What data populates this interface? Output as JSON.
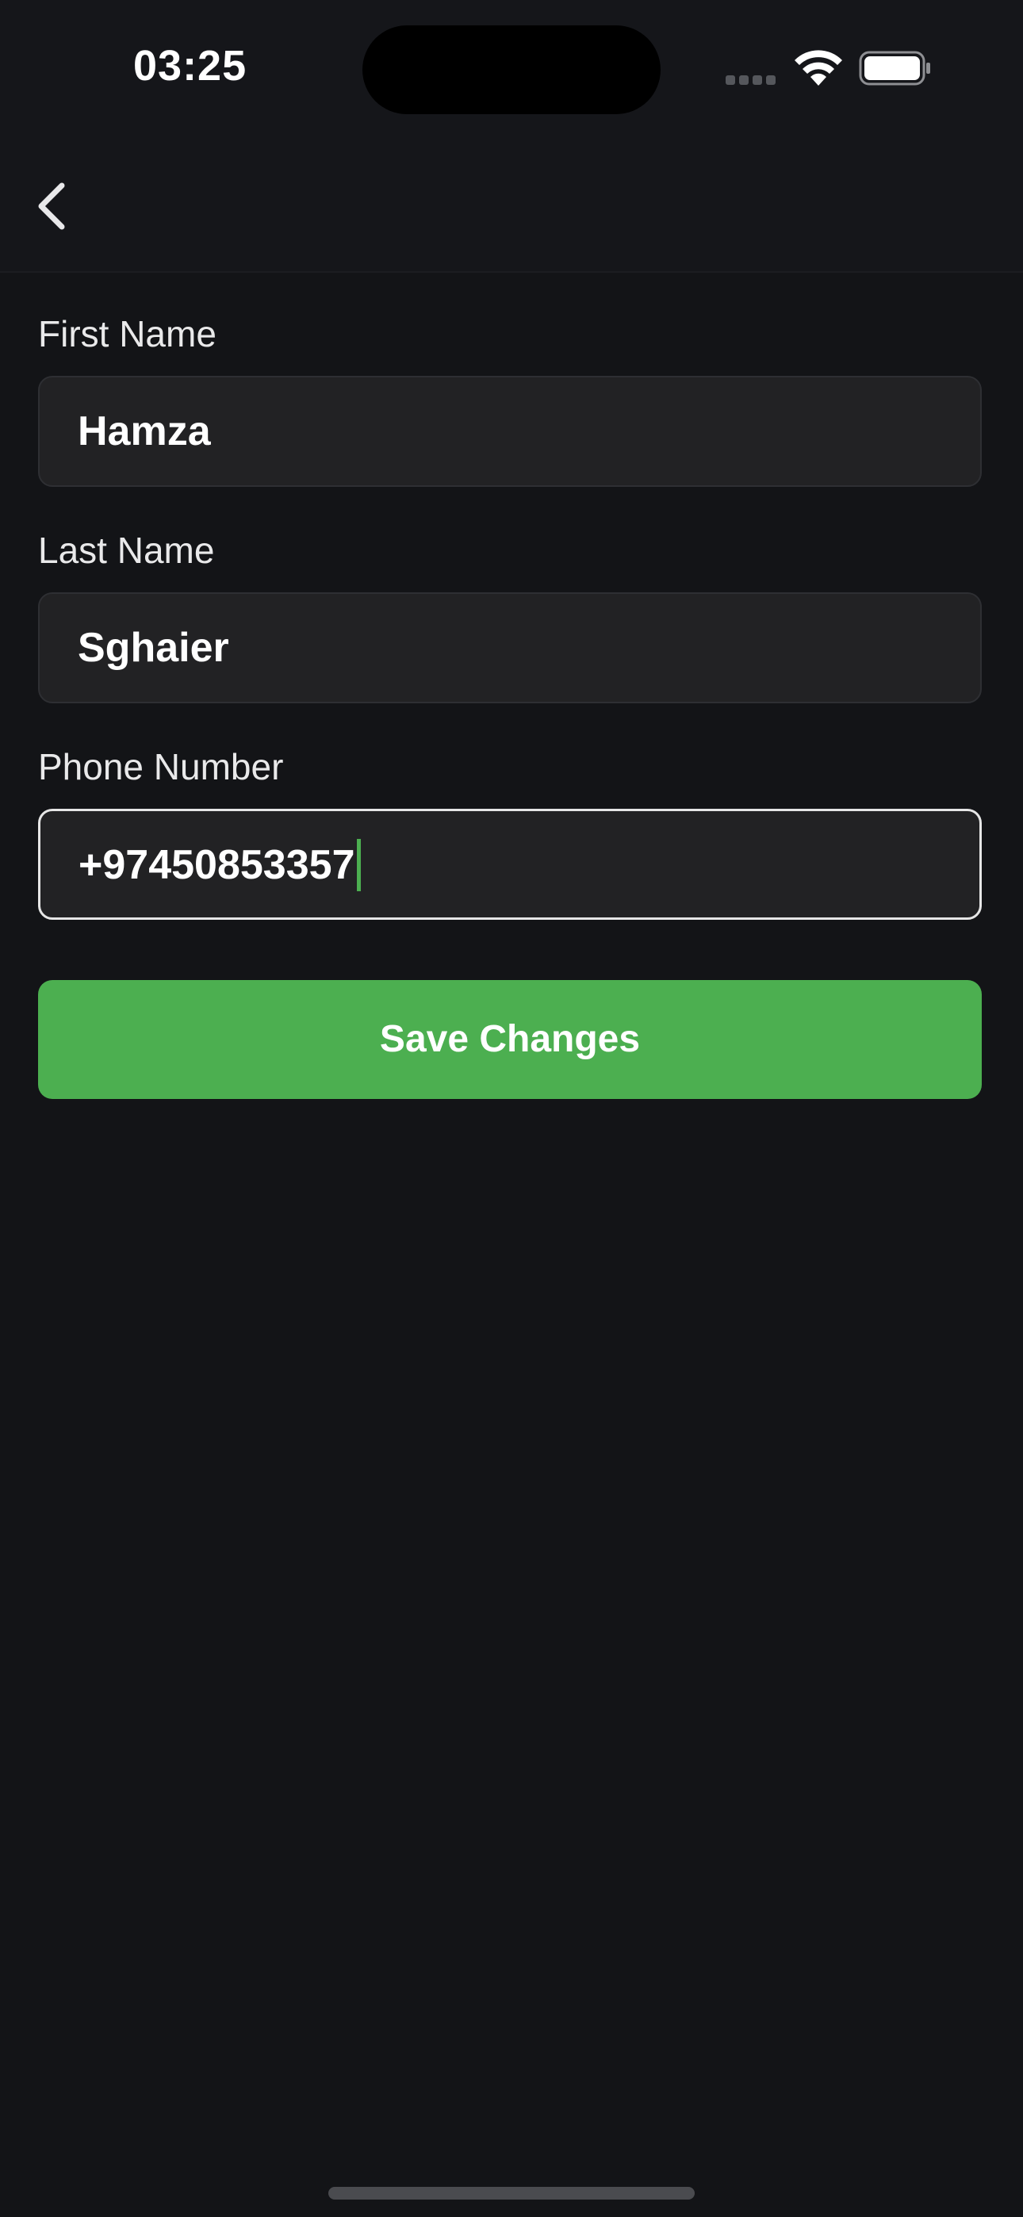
{
  "status_bar": {
    "time": "03:25",
    "icons": [
      "signal-icon",
      "wifi-icon",
      "battery-icon"
    ]
  },
  "header": {
    "back_icon": "chevron-left-icon"
  },
  "form": {
    "first_name": {
      "label": "First Name",
      "value": "Hamza"
    },
    "last_name": {
      "label": "Last Name",
      "value": "Sghaier"
    },
    "phone_number": {
      "label": "Phone Number",
      "value": "+97450853357"
    },
    "save_label": "Save Changes"
  },
  "colors": {
    "background": "#131417",
    "field_background": "#222224",
    "accent": "#4caf50",
    "text": "#ffffff"
  }
}
